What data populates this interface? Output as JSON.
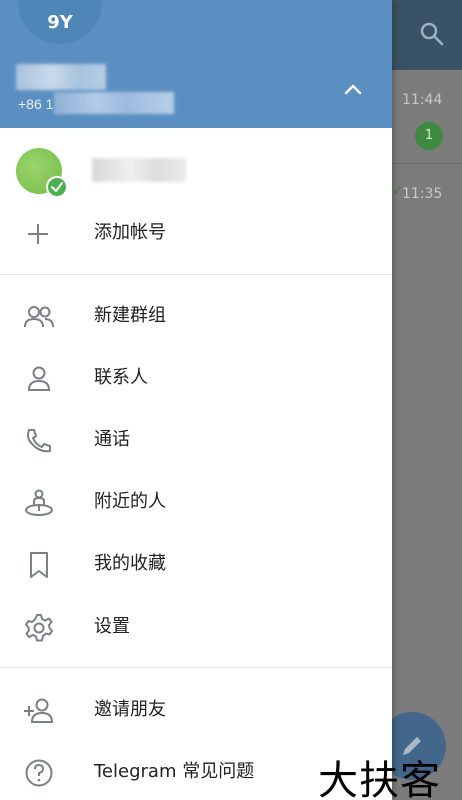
{
  "drawer": {
    "header": {
      "avatar_initials": "9Y",
      "phone_prefix": "+86 1",
      "header_color": "#5b8fc2"
    },
    "add_account_label": "添加帐号",
    "menu": [
      {
        "label": "新建群组",
        "icon": "new-group-icon"
      },
      {
        "label": "联系人",
        "icon": "contacts-icon"
      },
      {
        "label": "通话",
        "icon": "calls-icon"
      },
      {
        "label": "附近的人",
        "icon": "people-nearby-icon"
      },
      {
        "label": "我的收藏",
        "icon": "saved-messages-icon"
      },
      {
        "label": "设置",
        "icon": "settings-icon"
      }
    ],
    "secondary_menu": [
      {
        "label": "邀请朋友",
        "icon": "invite-friends-icon"
      },
      {
        "label": "Telegram 常见问题",
        "icon": "faq-icon"
      }
    ]
  },
  "background_chats": {
    "times": [
      "11:44",
      "11:35"
    ],
    "unread_badge": "1"
  },
  "watermark": "大扶客"
}
